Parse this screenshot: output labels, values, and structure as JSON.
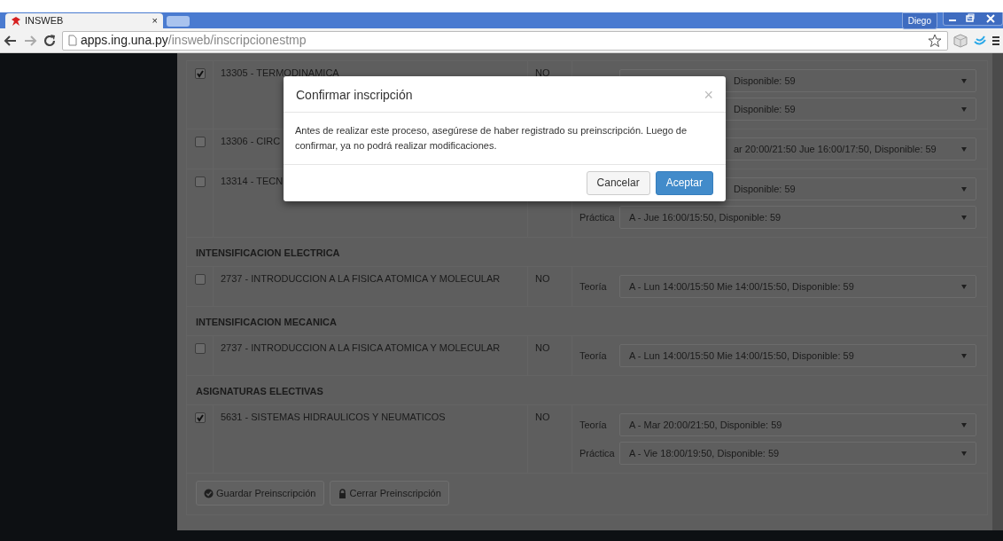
{
  "browser": {
    "tab_title": "INSWEB",
    "tab_close": "×",
    "address_host": "apps.ing.una.py",
    "address_path": "/insweb/inscripcionestmp",
    "profile": "Diego"
  },
  "sections": [
    {
      "rows": [
        {
          "checked": true,
          "name": "13305 - TERMODINAMICA",
          "column_3": "NO",
          "schedules": [
            {
              "value": "Disponible: 59",
              "covered": true
            },
            {
              "value": "Disponible: 59",
              "covered": true
            }
          ]
        },
        {
          "checked": false,
          "name": "13306 - CIRC",
          "schedules": [
            {
              "value": "ar 20:00/21:50 Jue 16:00/17:50, Disponible: 59",
              "covered": true
            }
          ]
        },
        {
          "checked": false,
          "name": "13314 - TECN",
          "schedules": [
            {
              "value": "Disponible: 59",
              "covered": true
            },
            {
              "label": "Práctica",
              "value": "A - Jue 16:00/15:50, Disponible: 59",
              "covered": false
            }
          ]
        }
      ]
    },
    {
      "title": "INTENSIFICACION ELECTRICA",
      "rows": [
        {
          "checked": false,
          "name": "2737 - INTRODUCCION A LA FISICA ATOMICA Y MOLECULAR",
          "column_3": "NO",
          "schedules": [
            {
              "label": "Teoría",
              "value": "A - Lun 14:00/15:50 Mie 14:00/15:50, Disponible: 59",
              "covered": false
            }
          ]
        }
      ]
    },
    {
      "title": "INTENSIFICACION MECANICA",
      "rows": [
        {
          "checked": false,
          "name": "2737 - INTRODUCCION A LA FISICA ATOMICA Y MOLECULAR",
          "column_3": "NO",
          "schedules": [
            {
              "label": "Teoría",
              "value": "A - Lun 14:00/15:50 Mie 14:00/15:50, Disponible: 59",
              "covered": false
            }
          ]
        }
      ]
    },
    {
      "title": "ASIGNATURAS ELECTIVAS",
      "rows": [
        {
          "checked": true,
          "name": "5631 - SISTEMAS HIDRAULICOS Y NEUMATICOS",
          "column_3": "NO",
          "schedules": [
            {
              "label": "Teoría",
              "value": "A - Mar 20:00/21:50, Disponible: 59",
              "covered": false
            },
            {
              "label": "Práctica",
              "value": "A - Vie 18:00/19:50, Disponible: 59",
              "covered": false
            }
          ]
        }
      ]
    }
  ],
  "actions": [
    {
      "kind": "save",
      "label": "Guardar Preinscripción"
    },
    {
      "kind": "lock",
      "label": "Cerrar Preinscripción"
    }
  ],
  "modal": {
    "title": "Confirmar inscripción",
    "close": "×",
    "body": "Antes de realizar este proceso, asegúrese de haber registrado su preinscripción. Luego de confirmar, ya no podrá realizar modificaciones.",
    "buttons": [
      {
        "kind": "secondary",
        "label": "Cancelar"
      },
      {
        "kind": "primary",
        "label": "Aceptar"
      }
    ]
  }
}
